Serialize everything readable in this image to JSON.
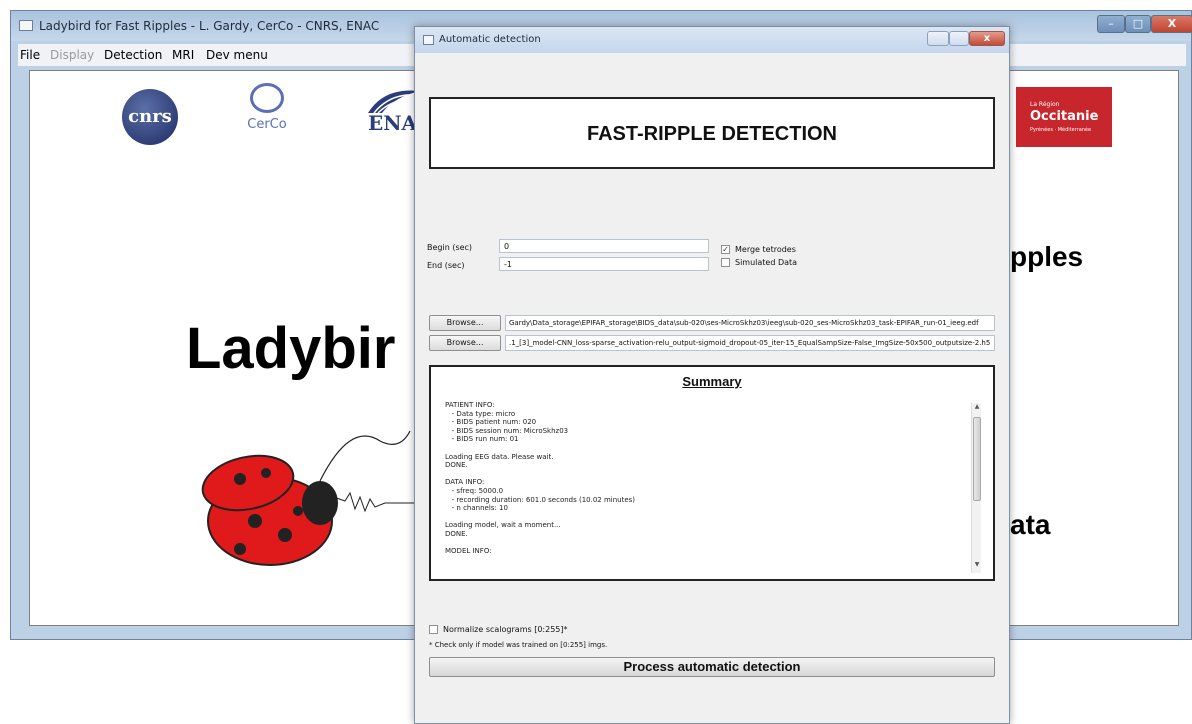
{
  "main_window": {
    "title": "Ladybird for Fast Ripples - L. Gardy, CerCo - CNRS, ENAC",
    "menu": [
      {
        "label": "File",
        "enabled": true
      },
      {
        "label": "Display",
        "enabled": false
      },
      {
        "label": "Detection",
        "enabled": true
      },
      {
        "label": "MRI",
        "enabled": true
      },
      {
        "label": "Dev menu",
        "enabled": true
      }
    ],
    "logos": {
      "cnrs": "cnrs",
      "cerco": "CerCo",
      "enac": "ENA",
      "occitanie_small": "La Région",
      "occitanie_big": "Occitanie",
      "occitanie_sub": "Pyrénées · Méditerranée"
    },
    "splash_title": "Ladybir",
    "splash_right_top": "pples",
    "splash_right_bottom": "ata",
    "close_glyph": "X"
  },
  "dialog": {
    "title": "Automatic detection",
    "heading": "FAST-RIPPLE DETECTION",
    "begin_label": "Begin (sec)",
    "begin_value": "0",
    "end_label": "End (sec)",
    "end_value": "-1",
    "merge_tetrodes_label": "Merge tetrodes",
    "merge_tetrodes_checked": true,
    "simulated_data_label": "Simulated Data",
    "simulated_data_checked": false,
    "browse_label": "Browse...",
    "file_path_1": "Gardy\\Data_storage\\EPIFAR_storage\\BIDS_data\\sub-020\\ses-MicroSkhz03\\ieeg\\sub-020_ses-MicroSkhz03_task-EPIFAR_run-01_ieeg.edf",
    "file_path_2": ".1_[3]_model-CNN_loss-sparse_activation-relu_output-sigmoid_dropout-05_iter-15_EqualSampSize-False_ImgSize-50x500_outputsize-2.h5",
    "summary_title": "Summary",
    "summary_log": "PATIENT INFO:\n   - Data type: micro\n   - BIDS patient num: 020\n   - BIDS session num: MicroSkhz03\n   - BIDS run num: 01\n\nLoading EEG data. Please wait.\nDONE.\n\nDATA INFO:\n   - sfreq: 5000.0\n   - recording duration: 601.0 seconds (10.02 minutes)\n   - n channels: 10\n\nLoading model, wait a moment...\nDONE.\n\nMODEL INFO:",
    "normalize_label": "Normalize scalograms [0:255]*",
    "normalize_checked": false,
    "normalize_note": "* Check only if model was trained on [0:255] imgs.",
    "process_label": "Process automatic detection",
    "close_glyph": "x"
  },
  "colors": {
    "occitanie_red": "#c8262d",
    "cnrs_blue": "#1e2a62",
    "ladybug_red": "#e0191b"
  }
}
